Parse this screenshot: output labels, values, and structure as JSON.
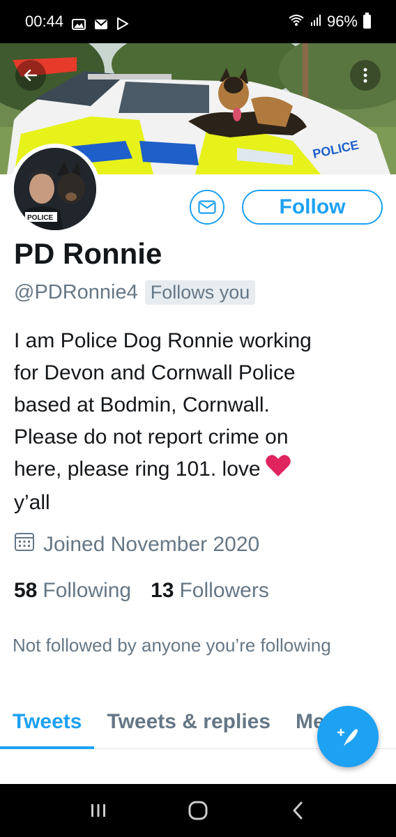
{
  "status_bar": {
    "time": "00:44",
    "battery": "96%",
    "icons": [
      "gallery-icon",
      "mail-icon",
      "play-store-icon",
      "wifi-icon",
      "signal-icon",
      "battery-icon"
    ]
  },
  "profile": {
    "display_name": "PD Ronnie",
    "handle": "@PDRonnie4",
    "follows_you": "Follows you",
    "bio_lines": [
      "I am Police Dog Ronnie working",
      "for Devon and Cornwall Police",
      "based at Bodmin, Cornwall.",
      "Please do not report crime on",
      "here, please ring 101. love",
      "y’all"
    ],
    "joined": "Joined November 2020",
    "following_count": "58",
    "following_label": "Following",
    "followers_count": "13",
    "followers_label": "Followers",
    "not_followed_text": "Not followed by anyone you’re following",
    "avatar_label": "POLICE",
    "banner_label": "POLICE"
  },
  "actions": {
    "follow_label": "Follow"
  },
  "tabs": [
    {
      "label": "Tweets",
      "active": true
    },
    {
      "label": "Tweets & replies",
      "active": false
    },
    {
      "label": "Media",
      "active": false
    }
  ],
  "colors": {
    "accent": "#1da1f2",
    "secondary_text": "#657786",
    "heart": "#e0245e"
  }
}
